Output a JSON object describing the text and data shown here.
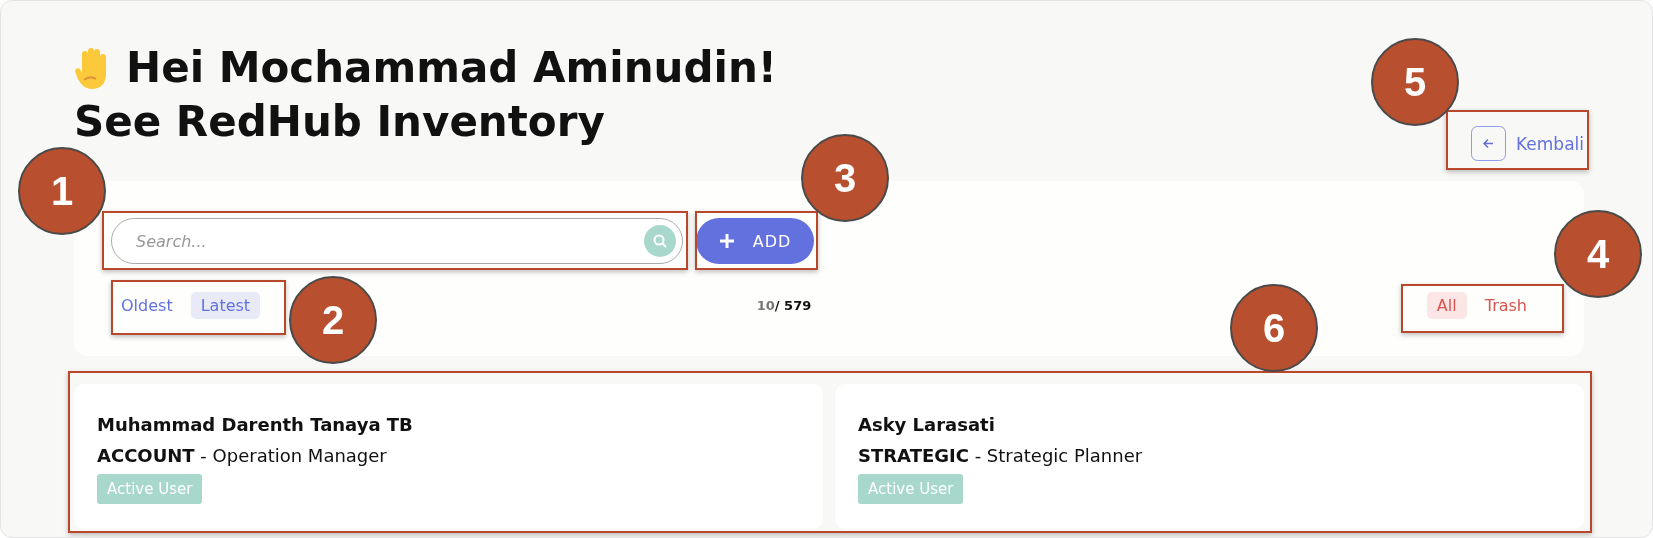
{
  "greeting": "Hei Mochammad Aminudin!",
  "subtitle": "See RedHub Inventory",
  "back_button": {
    "label": "Kembali"
  },
  "search": {
    "placeholder": "Search..."
  },
  "add_button": {
    "label": "ADD"
  },
  "sort_options": [
    {
      "label": "Oldest",
      "selected": false
    },
    {
      "label": "Latest",
      "selected": true
    }
  ],
  "counter": {
    "shown": "10",
    "total": "/ 579"
  },
  "filters": [
    {
      "label": "All",
      "selected": true
    },
    {
      "label": "Trash",
      "selected": false
    }
  ],
  "users": [
    {
      "name": "Muhammad Darenth Tanaya TB",
      "role": "**ACCOUNT** - Operation Manager",
      "status": "Active User"
    },
    {
      "name": "Asky Larasati",
      "role": "**STRATEGIC** - Strategic Planner",
      "status": "Active User"
    }
  ],
  "callouts": [
    "1",
    "2",
    "3",
    "4",
    "5",
    "6"
  ]
}
